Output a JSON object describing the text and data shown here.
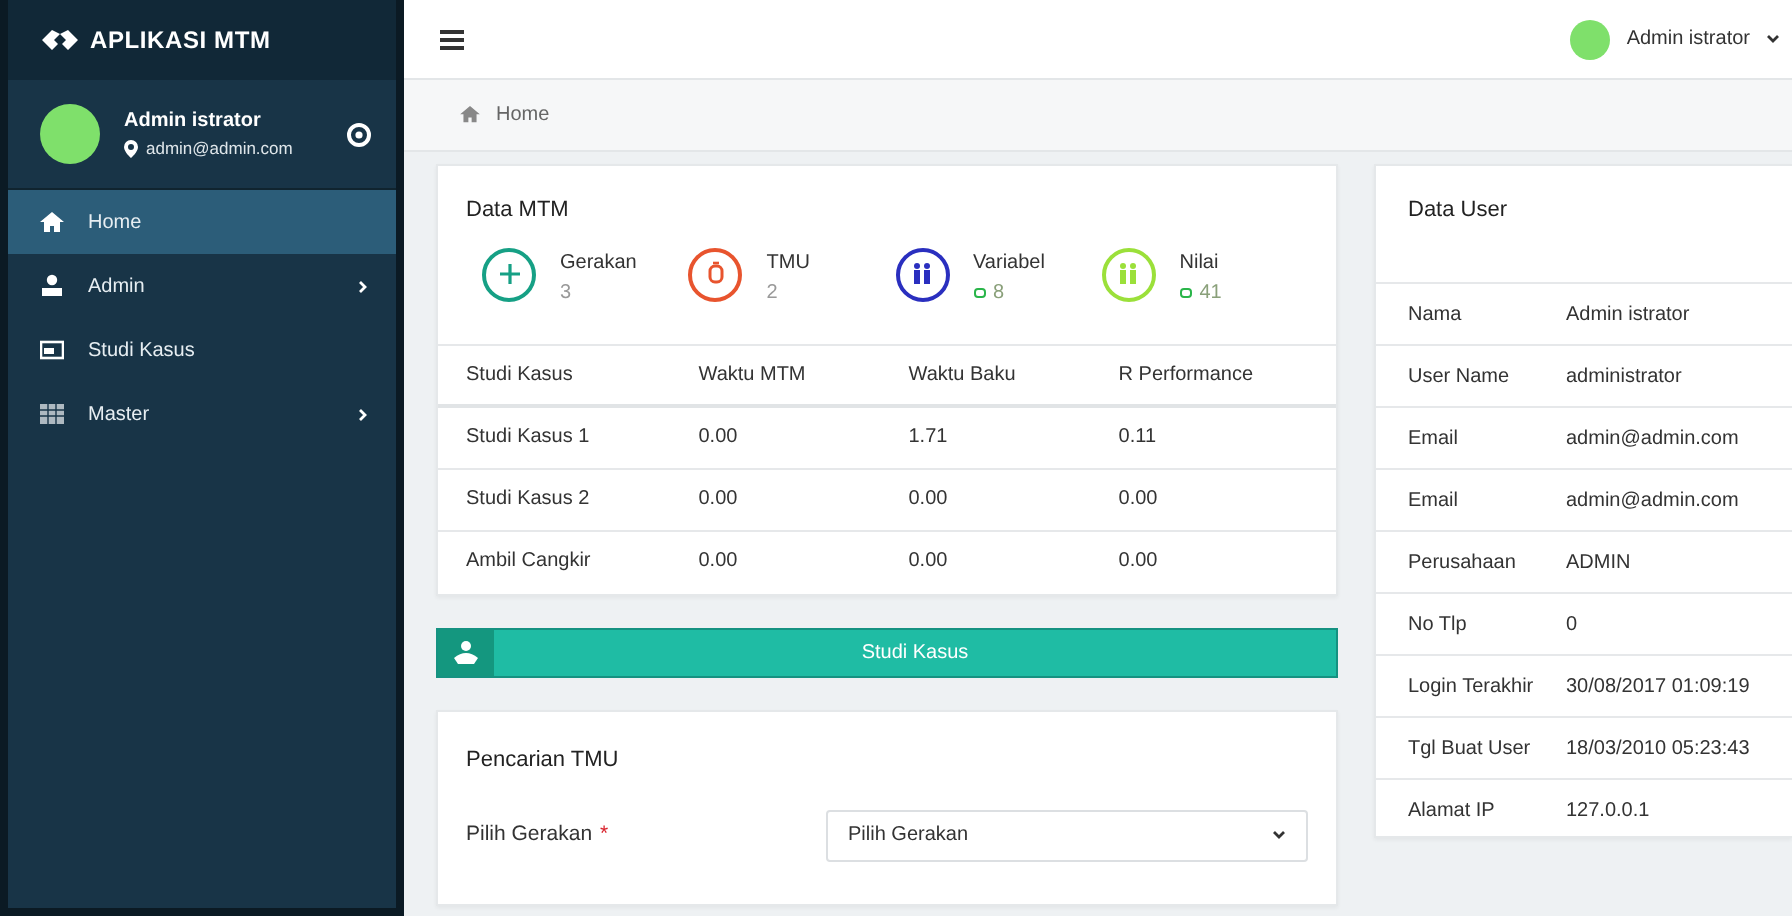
{
  "brand": {
    "title": "APLIKASI MTM"
  },
  "profile": {
    "name": "Admin istrator",
    "email": "admin@admin.com"
  },
  "menu": [
    {
      "label": "Home",
      "kind": "home",
      "selected": true,
      "has_submenu": false
    },
    {
      "label": "Admin",
      "kind": "user",
      "selected": false,
      "has_submenu": true
    },
    {
      "label": "Studi Kasus",
      "kind": "card",
      "selected": false,
      "has_submenu": false
    },
    {
      "label": "Master",
      "kind": "grid",
      "selected": false,
      "has_submenu": true
    }
  ],
  "topbar": {
    "user": "Admin istrator"
  },
  "breadcrumb": [
    "Home"
  ],
  "data_mtm": {
    "title": "Data MTM",
    "stats": [
      {
        "label": "Gerakan",
        "value": "3",
        "kind": "plus",
        "color": "#16a085",
        "indicator": false
      },
      {
        "label": "TMU",
        "value": "2",
        "kind": "timer",
        "color": "#e8542e",
        "indicator": false
      },
      {
        "label": "Variabel",
        "value": "8",
        "kind": "people",
        "color": "#2a2fbf",
        "indicator": true
      },
      {
        "label": "Nilai",
        "value": "41",
        "kind": "people",
        "color": "#9be03a",
        "indicator": true
      }
    ],
    "table": {
      "columns": [
        "Studi Kasus",
        "Waktu MTM",
        "Waktu Baku",
        "R Performance"
      ],
      "rows": [
        [
          "Studi Kasus 1",
          "0.00",
          "1.71",
          "0.11"
        ],
        [
          "Studi Kasus 2",
          "0.00",
          "0.00",
          "0.00"
        ],
        [
          "Ambil Cangkir",
          "0.00",
          "0.00",
          "0.00"
        ]
      ]
    }
  },
  "studi_kasus_bar": {
    "label": "Studi Kasus"
  },
  "pencarian": {
    "title": "Pencarian TMU",
    "field_label": "Pilih Gerakan",
    "required_mark": "*",
    "select_value": "Pilih Gerakan"
  },
  "data_user": {
    "title": "Data User",
    "rows": [
      {
        "label": "Nama",
        "value": "Admin istrator"
      },
      {
        "label": "User Name",
        "value": "administrator"
      },
      {
        "label": "Email",
        "value": "admin@admin.com"
      },
      {
        "label": "Email",
        "value": "admin@admin.com"
      },
      {
        "label": "Perusahaan",
        "value": "ADMIN"
      },
      {
        "label": "No Tlp",
        "value": "0"
      },
      {
        "label": "Login Terakhir",
        "value": "30/08/2017 01:09:19"
      },
      {
        "label": "Tgl Buat User",
        "value": "18/03/2010 05:23:43"
      },
      {
        "label": "Alamat IP",
        "value": "127.0.0.1"
      }
    ]
  }
}
